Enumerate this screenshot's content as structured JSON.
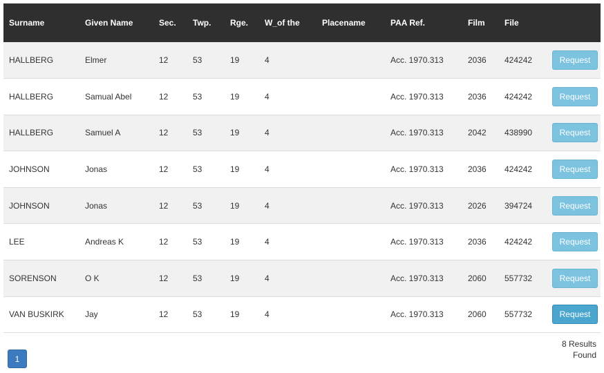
{
  "table": {
    "headers": [
      "Surname",
      "Given Name",
      "Sec.",
      "Twp.",
      "Rge.",
      "W_of the",
      "Placename",
      "PAA Ref.",
      "Film",
      "File",
      ""
    ],
    "rows": [
      {
        "surname": "HALLBERG",
        "given": "Elmer",
        "sec": "12",
        "twp": "53",
        "rge": "19",
        "w": "4",
        "place": "",
        "paa": "Acc. 1970.313",
        "film": "2036",
        "file": "424242",
        "action": "Request"
      },
      {
        "surname": "HALLBERG",
        "given": "Samual Abel",
        "sec": "12",
        "twp": "53",
        "rge": "19",
        "w": "4",
        "place": "",
        "paa": "Acc. 1970.313",
        "film": "2036",
        "file": "424242",
        "action": "Request"
      },
      {
        "surname": "HALLBERG",
        "given": "Samuel A",
        "sec": "12",
        "twp": "53",
        "rge": "19",
        "w": "4",
        "place": "",
        "paa": "Acc. 1970.313",
        "film": "2042",
        "file": "438990",
        "action": "Request"
      },
      {
        "surname": "JOHNSON",
        "given": "Jonas",
        "sec": "12",
        "twp": "53",
        "rge": "19",
        "w": "4",
        "place": "",
        "paa": "Acc. 1970.313",
        "film": "2036",
        "file": "424242",
        "action": "Request"
      },
      {
        "surname": "JOHNSON",
        "given": "Jonas",
        "sec": "12",
        "twp": "53",
        "rge": "19",
        "w": "4",
        "place": "",
        "paa": "Acc. 1970.313",
        "film": "2026",
        "file": "394724",
        "action": "Request"
      },
      {
        "surname": "LEE",
        "given": "Andreas K",
        "sec": "12",
        "twp": "53",
        "rge": "19",
        "w": "4",
        "place": "",
        "paa": "Acc. 1970.313",
        "film": "2036",
        "file": "424242",
        "action": "Request"
      },
      {
        "surname": "SORENSON",
        "given": "O K",
        "sec": "12",
        "twp": "53",
        "rge": "19",
        "w": "4",
        "place": "",
        "paa": "Acc. 1970.313",
        "film": "2060",
        "file": "557732",
        "action": "Request"
      },
      {
        "surname": "VAN BUSKIRK",
        "given": "Jay",
        "sec": "12",
        "twp": "53",
        "rge": "19",
        "w": "4",
        "place": "",
        "paa": "Acc. 1970.313",
        "film": "2060",
        "file": "557732",
        "action": "Request"
      }
    ]
  },
  "pagination": {
    "current_page": "1"
  },
  "results": {
    "line1": "8 Results",
    "line2": "Found"
  },
  "colors": {
    "header_bg": "#2f2f2f",
    "row_alt_bg": "#f1f1f1",
    "request_button": "#7cc3e0",
    "request_button_hover": "#4ba6cf",
    "pager_active": "#3c7bbf"
  }
}
